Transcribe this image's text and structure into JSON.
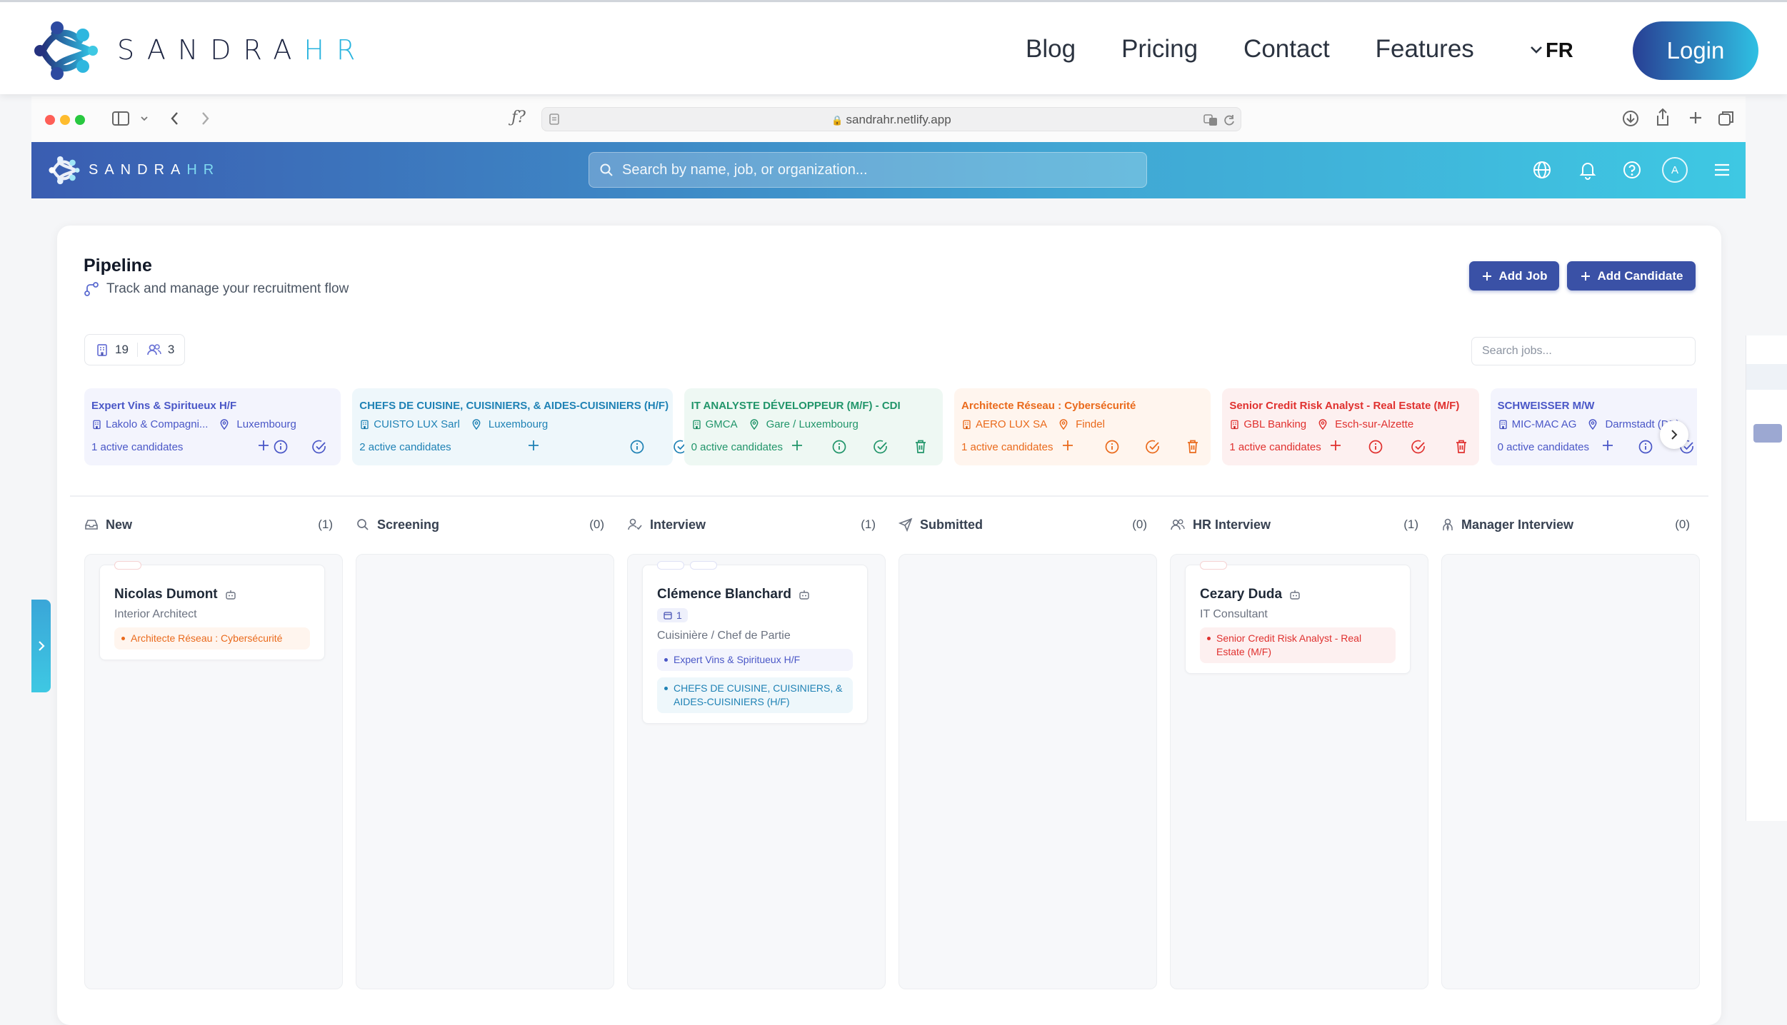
{
  "site": {
    "brand_main": "SANDRA",
    "brand_accent": "HR",
    "nav": [
      "Blog",
      "Pricing",
      "Contact"
    ],
    "features_label": "Features",
    "lang": "FR",
    "login_label": "Login"
  },
  "browser": {
    "url": "sandrahr.netlify.app"
  },
  "app": {
    "brand_main": "SANDRA",
    "brand_accent": "HR",
    "search_placeholder": "Search by name, job, or organization...",
    "avatar_initial": "A"
  },
  "pipeline": {
    "title": "Pipeline",
    "subtitle": "Track and manage your recruitment flow",
    "add_job_label": "Add Job",
    "add_candidate_label": "Add Candidate",
    "jobs_count": "19",
    "candidates_count": "3",
    "job_search_placeholder": "Search jobs..."
  },
  "jobs": [
    {
      "title": "Expert Vins & Spiritueux H/F",
      "company": "Lakolo & Compagni...",
      "location": "Luxembourg",
      "active": "1 active candidates",
      "color": "#4a57c7",
      "bg": "#f3f4fd"
    },
    {
      "title": "CHEFS DE CUISINE, CUISINIERS, & AIDES-CUISINIERS (H/F)",
      "company": "CUISTO LUX Sarl",
      "location": "Luxembourg",
      "active": "2 active candidates",
      "color": "#1f82b5",
      "bg": "#eef7fb"
    },
    {
      "title": "IT ANALYSTE DÉVELOPPEUR (M/F) - CDI",
      "company": "GMCA",
      "location": "Gare / Luxembourg",
      "active": "0 active candidates",
      "color": "#21956a",
      "bg": "#eef8f3"
    },
    {
      "title": "Architecte Réseau : Cybersécurité",
      "company": "AERO LUX SA",
      "location": "Findel",
      "active": "1 active candidates",
      "color": "#ea6a1c",
      "bg": "#fff5ee"
    },
    {
      "title": "Senior Credit Risk Analyst - Real Estate (M/F)",
      "company": "GBL Banking",
      "location": "Esch-sur-Alzette",
      "active": "1 active candidates",
      "color": "#e0312f",
      "bg": "#fdf0f0"
    },
    {
      "title": "SCHWEISSER M/W",
      "company": "MIC-MAC AG",
      "location": "Darmstadt (DE)",
      "active": "0 active candidates",
      "color": "#4a57c7",
      "bg": "#f3f4fd"
    }
  ],
  "columns": [
    {
      "name": "New",
      "count": "(1)",
      "icon": "inbox-icon"
    },
    {
      "name": "Screening",
      "count": "(0)",
      "icon": "search-icon"
    },
    {
      "name": "Interview",
      "count": "(1)",
      "icon": "user-check-icon"
    },
    {
      "name": "Submitted",
      "count": "(0)",
      "icon": "send-icon"
    },
    {
      "name": "HR Interview",
      "count": "(1)",
      "icon": "users-icon"
    },
    {
      "name": "Manager Interview",
      "count": "(0)",
      "icon": "user-tie-icon"
    }
  ],
  "candidates": {
    "nicolas": {
      "name": "Nicolas Dumont",
      "role": "Interior Architect",
      "tags": [
        "Architecte Réseau : Cybersécurité"
      ]
    },
    "clemence": {
      "name": "Clémence Blanchard",
      "badge": "1",
      "role": "Cuisinière / Chef de Partie",
      "tags": [
        "Expert Vins & Spiritueux H/F",
        "CHEFS DE CUISINE, CUISINIERS, & AIDES-CUISINIERS (H/F)"
      ]
    },
    "cezary": {
      "name": "Cezary Duda",
      "role": "IT Consultant",
      "tags": [
        "Senior Credit Risk Analyst - Real Estate (M/F)"
      ]
    }
  }
}
